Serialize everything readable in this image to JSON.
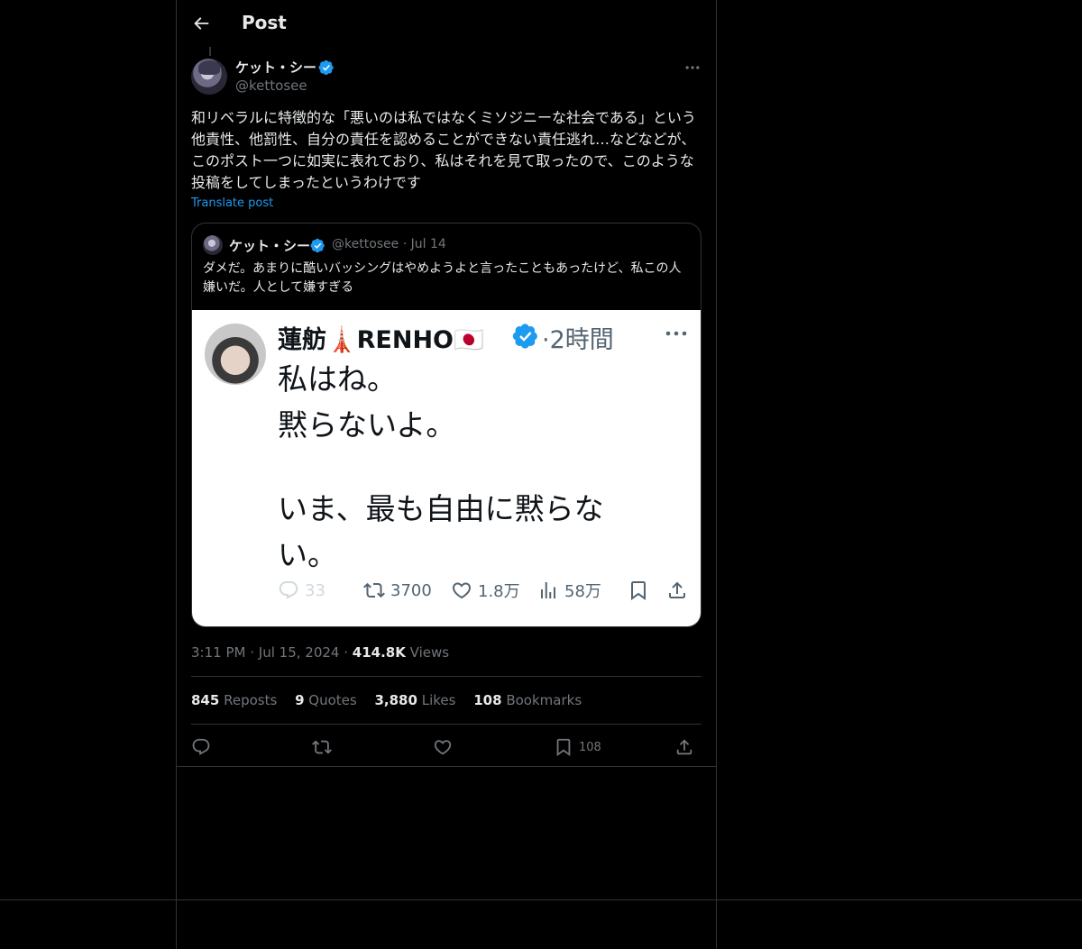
{
  "header": {
    "title": "Post"
  },
  "post": {
    "author_name": "ケット・シー",
    "author_handle": "@kettosee",
    "text": "和リベラルに特徴的な「悪いのは私ではなくミソジニーな社会である」という他責性、他罰性、自分の責任を認めることができない責任逃れ…などなどが、このポスト一つに如実に表れており、私はそれを見て取ったので、このような投稿をしてしまったというわけです",
    "translate_label": "Translate post",
    "time": "3:11 PM",
    "date": "Jul 15, 2024",
    "views_count": "414.8K",
    "views_label": "Views"
  },
  "quote": {
    "author_name": "ケット・シー",
    "author_handle": "@kettosee",
    "date": "Jul 14",
    "text": "ダメだ。あまりに酷いバッシングはやめようよと言ったこともあったけど、私この人嫌いだ。人として嫌すぎる",
    "screenshot": {
      "name": "蓮舫🗼RENHO🇯🇵",
      "time": "·2時間",
      "lines": [
        "私はね。",
        "黙らないよ。",
        "いま、最も自由に黙らな",
        "い。"
      ],
      "replies": "33",
      "reposts": "3700",
      "likes": "1.8万",
      "views": "58万"
    }
  },
  "stats": {
    "reposts_count": "845",
    "reposts_label": "Reposts",
    "quotes_count": "9",
    "quotes_label": "Quotes",
    "likes_count": "3,880",
    "likes_label": "Likes",
    "bookmarks_count": "108",
    "bookmarks_label": "Bookmarks"
  },
  "actions": {
    "bookmark_count": "108"
  },
  "colors": {
    "background": "#000000",
    "accent": "#1d9bf0",
    "border": "#2f3336",
    "muted": "#71767b"
  },
  "icons": [
    "back-arrow-icon",
    "verified-badge-icon",
    "more-icon",
    "reply-icon",
    "repost-icon",
    "like-icon",
    "bookmark-icon",
    "share-icon",
    "views-icon"
  ]
}
